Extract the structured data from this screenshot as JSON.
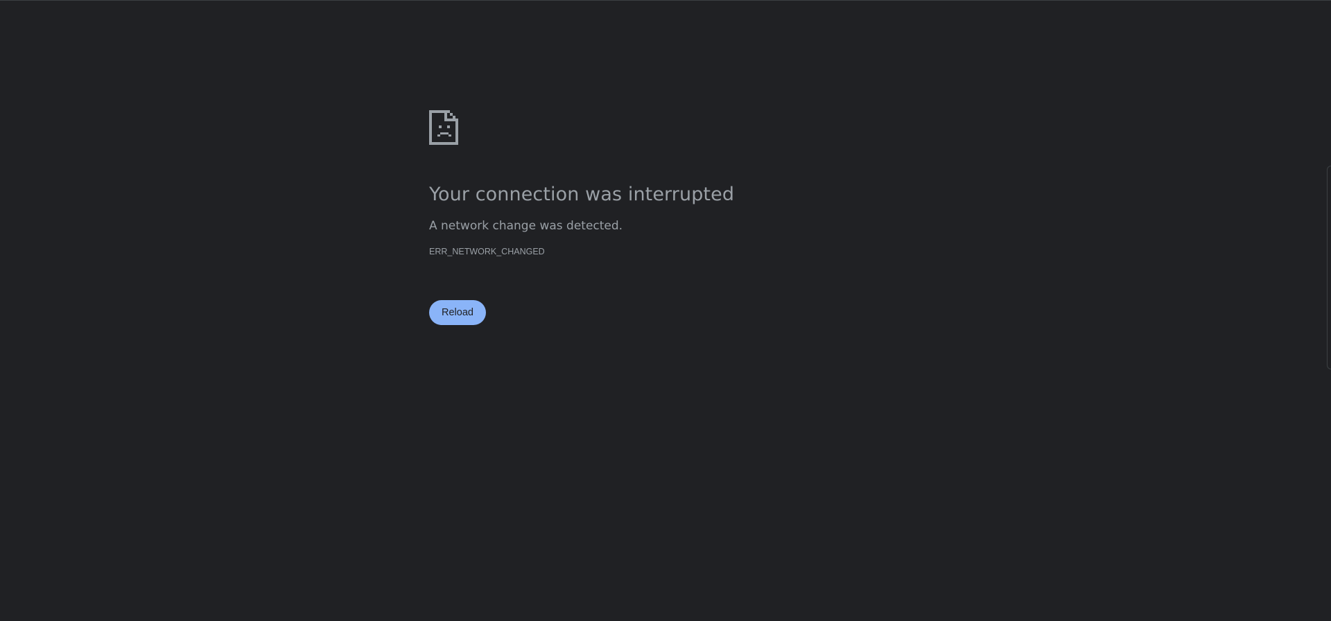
{
  "error": {
    "icon": "sad-document-icon",
    "title": "Your connection was interrupted",
    "description": "A network change was detected.",
    "code": "ERR_NETWORK_CHANGED",
    "reload_label": "Reload"
  },
  "colors": {
    "background": "#202124",
    "text": "#9aa0a6",
    "button": "#8ab4f8",
    "button_text": "#202124"
  }
}
